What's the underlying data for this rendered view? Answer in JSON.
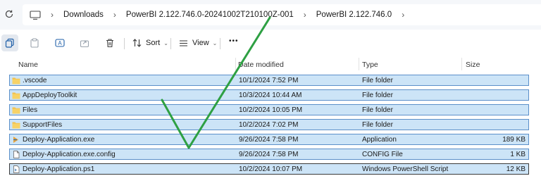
{
  "address_bar": {
    "breadcrumbs": [
      "Downloads",
      "PowerBI 2.122.746.0-20241002T210100Z-001",
      "PowerBI 2.122.746.0"
    ]
  },
  "toolbar": {
    "sort_label": "Sort",
    "view_label": "View",
    "more_label": "•••"
  },
  "columns": {
    "name": "Name",
    "date": "Date modified",
    "type": "Type",
    "size": "Size"
  },
  "files": [
    {
      "name": ".vscode",
      "date": "10/1/2024 7:52 PM",
      "type": "File folder",
      "size": "",
      "icon": "folder-icon"
    },
    {
      "name": "AppDeployToolkit",
      "date": "10/3/2024 10:44 AM",
      "type": "File folder",
      "size": "",
      "icon": "folder-icon"
    },
    {
      "name": "Files",
      "date": "10/2/2024 10:05 PM",
      "type": "File folder",
      "size": "",
      "icon": "folder-icon"
    },
    {
      "name": "SupportFiles",
      "date": "10/2/2024 7:02 PM",
      "type": "File folder",
      "size": "",
      "icon": "folder-icon"
    },
    {
      "name": "Deploy-Application.exe",
      "date": "9/26/2024 7:58 PM",
      "type": "Application",
      "size": "189 KB",
      "icon": "exe-icon"
    },
    {
      "name": "Deploy-Application.exe.config",
      "date": "9/26/2024 7:58 PM",
      "type": "CONFIG File",
      "size": "1 KB",
      "icon": "config-file-icon"
    },
    {
      "name": "Deploy-Application.ps1",
      "date": "10/2/2024 10:07 PM",
      "type": "Windows PowerShell Script",
      "size": "12 KB",
      "icon": "powershell-file-icon"
    }
  ],
  "colors": {
    "selection_fill": "#cce4f7",
    "selection_border": "#5b8fc9",
    "checkmark": "#2ea043",
    "folder": "#f2c04b"
  }
}
